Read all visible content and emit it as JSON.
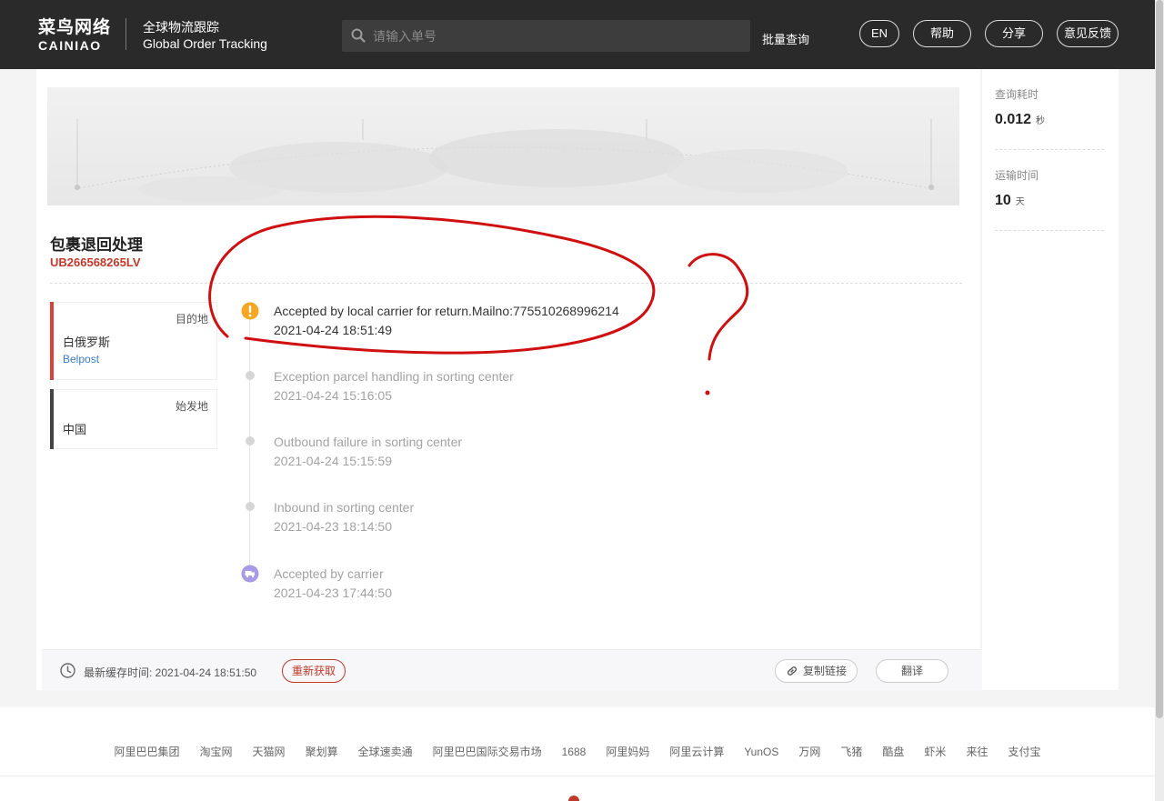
{
  "header": {
    "logo_cn": "菜鸟网络",
    "logo_en": "CAINIAO",
    "subtitle_cn": "全球物流跟踪",
    "subtitle_en": "Global Order Tracking",
    "search_placeholder": "请输入单号",
    "batch_query": "批量查询",
    "buttons": {
      "lang": "EN",
      "help": "帮助",
      "share": "分享",
      "feedback": "意见反馈"
    }
  },
  "package": {
    "status": "包裹退回处理",
    "tracking_number": "UB266568265LV"
  },
  "destination": {
    "tag": "目的地",
    "place": "白俄罗斯",
    "carrier": "Belpost"
  },
  "origin": {
    "tag": "始发地",
    "place": "中国"
  },
  "events": [
    {
      "title": "Accepted by local carrier for return.Mailno:775510268996214",
      "time": "2021-04-24 18:51:49"
    },
    {
      "title": "Exception parcel handling in sorting center",
      "time": "2021-04-24 15:16:05"
    },
    {
      "title": "Outbound failure in sorting center",
      "time": "2021-04-24 15:15:59"
    },
    {
      "title": "Inbound in sorting center",
      "time": "2021-04-23 18:14:50"
    },
    {
      "title": "Accepted by carrier",
      "time": "2021-04-23 17:44:50"
    }
  ],
  "footer_bar": {
    "cache_time": "最新缓存时间: 2021-04-24 18:51:50",
    "refetch": "重新获取",
    "copy_link": "复制链接",
    "translate": "翻译"
  },
  "sidebar": {
    "query_time_label": "查询耗时",
    "query_time_value": "0.012",
    "query_time_unit": "秒",
    "transit_label": "运输时间",
    "transit_value": "10",
    "transit_unit": "天"
  },
  "bottom_links": [
    "阿里巴巴集团",
    "淘宝网",
    "天猫网",
    "聚划算",
    "全球速卖通",
    "阿里巴巴国际交易市场",
    "1688",
    "阿里妈妈",
    "阿里云计算",
    "YunOS",
    "万网",
    "飞猪",
    "酷盘",
    "虾米",
    "来往",
    "支付宝"
  ],
  "colors": {
    "header_bg": "#2a2a2a",
    "accent_red": "#c0392b",
    "warning_orange": "#f5a623",
    "carrier_purple": "#a89ae6",
    "link_blue": "#3b7ec8"
  }
}
